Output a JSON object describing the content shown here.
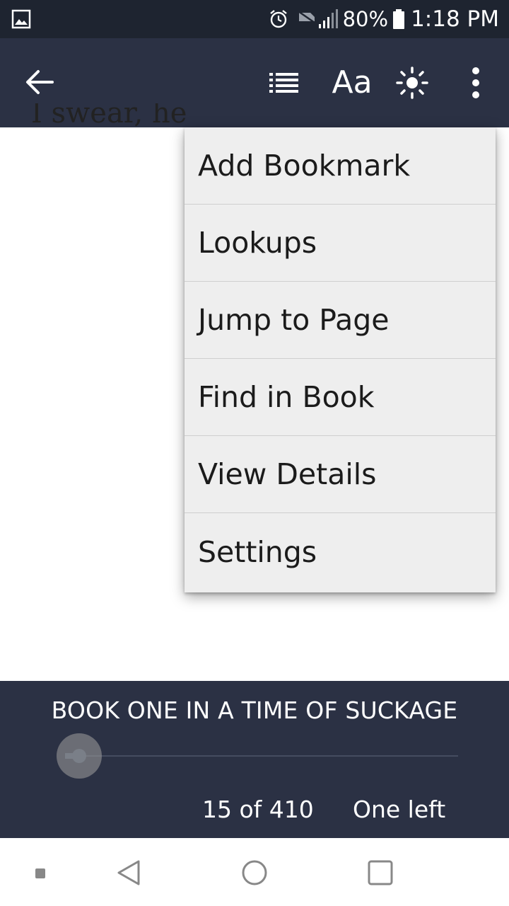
{
  "status_bar": {
    "battery_percent": "80%",
    "time": "1:18 PM",
    "icons": [
      "gallery-icon",
      "alarm-icon",
      "no-sim-icon",
      "signal-icon",
      "battery-icon"
    ]
  },
  "app_bar": {
    "icons": [
      "back-arrow-icon",
      "table-of-contents-icon",
      "font-settings-icon",
      "brightness-icon",
      "more-vert-icon"
    ],
    "font_label": "Aa"
  },
  "page": {
    "visible_text": "I swear, he an"
  },
  "menu": {
    "items": [
      {
        "label": "Add Bookmark"
      },
      {
        "label": "Lookups"
      },
      {
        "label": "Jump to Page"
      },
      {
        "label": "Find in Book"
      },
      {
        "label": "View Details"
      },
      {
        "label": "Settings"
      }
    ]
  },
  "reader_footer": {
    "book_title": "BOOK ONE IN A TIME OF SUCKAGE",
    "progress_fraction": 0.036,
    "page_count": "15 of 410",
    "time_left": "One left"
  },
  "colors": {
    "status_bar": "#1e2430",
    "app_bar": "#2b3144",
    "menu_bg": "#eeeeee",
    "menu_text": "#1b1b1b"
  }
}
